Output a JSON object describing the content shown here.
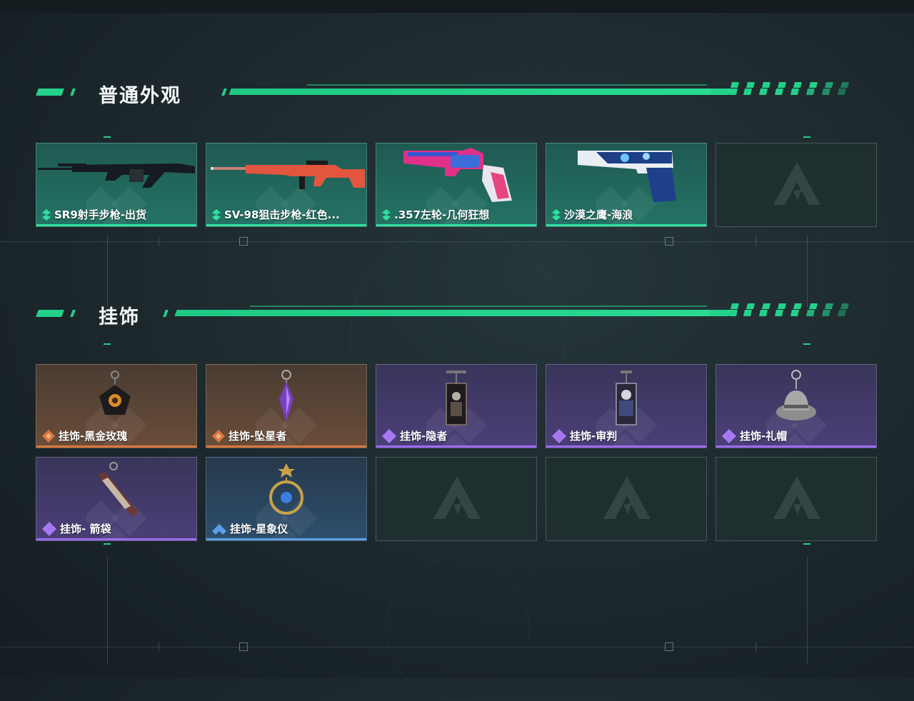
{
  "sections": {
    "skins": {
      "title": "普通外观",
      "items": [
        {
          "name": "SR9射手步枪-出货",
          "rarity": "green",
          "icon": "rifle-icon"
        },
        {
          "name": "SV-98狙击步枪-红色...",
          "rarity": "green",
          "icon": "sniper-rifle-icon"
        },
        {
          "name": ".357左轮-几何狂想",
          "rarity": "green",
          "icon": "revolver-icon"
        },
        {
          "name": "沙漠之鹰-海浪",
          "rarity": "green",
          "icon": "pistol-icon"
        }
      ]
    },
    "charms": {
      "title": "挂饰",
      "items": [
        {
          "name": "挂饰-黑金玫瑰",
          "rarity": "orange",
          "icon": "rose-charm-icon"
        },
        {
          "name": "挂饰-坠星者",
          "rarity": "orange",
          "icon": "crystal-charm-icon"
        },
        {
          "name": "挂饰-隐者",
          "rarity": "purple",
          "icon": "tarot-card-icon"
        },
        {
          "name": "挂饰-审判",
          "rarity": "purple",
          "icon": "tarot-card-icon"
        },
        {
          "name": "挂饰-礼帽",
          "rarity": "purple",
          "icon": "hat-charm-icon"
        },
        {
          "name": "挂饰- 箭袋",
          "rarity": "purple",
          "icon": "quiver-charm-icon"
        },
        {
          "name": "挂饰-星象仪",
          "rarity": "blue",
          "icon": "astrolabe-charm-icon"
        }
      ]
    }
  },
  "colors": {
    "accent": "#23d18b",
    "rarity_green": "#2fe0a0",
    "rarity_orange": "#d9773d",
    "rarity_purple": "#9b6cf0",
    "rarity_blue": "#5aa0e8"
  }
}
